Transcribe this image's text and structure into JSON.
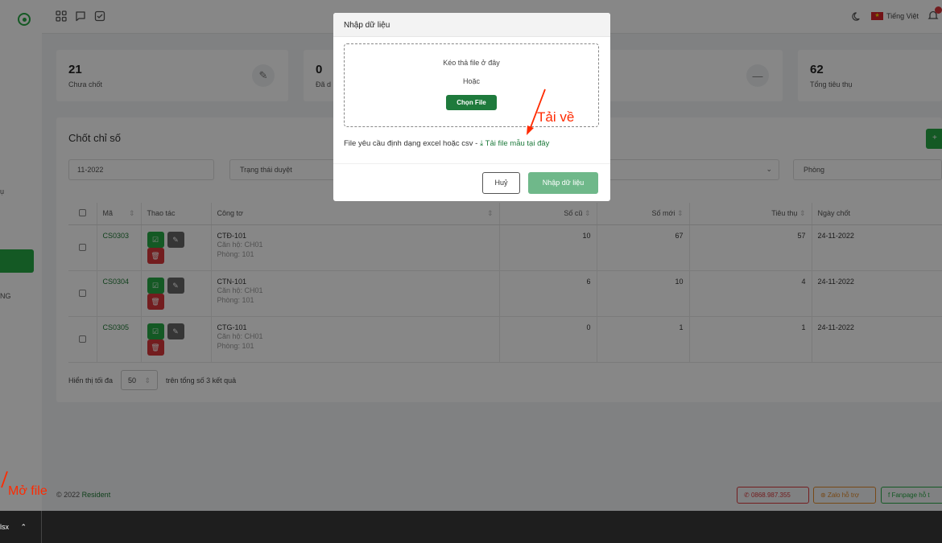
{
  "topbar": {
    "language": "Tiếng Việt"
  },
  "stats": [
    {
      "value": "21",
      "label": "Chưa chốt"
    },
    {
      "value": "0",
      "label": "Đã d"
    },
    {
      "value": "62",
      "label": "Tổng tiêu thụ"
    }
  ],
  "panel": {
    "title": "Chốt chỉ số",
    "filter_month": "11-2022",
    "filter_status": "Trạng thái duyệt",
    "filter_room": "Phòng",
    "add_label": "+"
  },
  "sidebar": {
    "fragment1": "ụ",
    "fragment2": "NG"
  },
  "table": {
    "headers": {
      "ma": "Mã",
      "thaotac": "Thao tác",
      "congto": "Công tơ",
      "socu": "Số cũ",
      "somoi": "Số mới",
      "tieuthu": "Tiêu thụ",
      "ngaychot": "Ngày chốt"
    },
    "rows": [
      {
        "code": "CS0303",
        "meter": "CTĐ-101",
        "apt": "Căn hộ: CH01",
        "room": "Phòng: 101",
        "old": "10",
        "new": "67",
        "usage": "57",
        "date": "24-11-2022"
      },
      {
        "code": "CS0304",
        "meter": "CTN-101",
        "apt": "Căn hộ: CH01",
        "room": "Phòng: 101",
        "old": "6",
        "new": "10",
        "usage": "4",
        "date": "24-11-2022"
      },
      {
        "code": "CS0305",
        "meter": "CTG-101",
        "apt": "Căn hộ: CH01",
        "room": "Phòng: 101",
        "old": "0",
        "new": "1",
        "usage": "1",
        "date": "24-11-2022"
      }
    ]
  },
  "pagination": {
    "prefix": "Hiển thị tối đa",
    "size": "50",
    "suffix": "trên tổng số 3 kết quả"
  },
  "footer": {
    "copyright": "© 2022",
    "brand": "Resident",
    "phone": "0868.987.355",
    "zalo": "Zalo hỗ trợ",
    "fanpage": "Fanpage hỗ t"
  },
  "taskbar": {
    "file": "lsx"
  },
  "modal": {
    "title": "Nhập dữ liệu",
    "drop_text": "Kéo thả file ở đây",
    "or_text": "Hoặc",
    "choose_label": "Chọn File",
    "note_text": "File yêu cầu định dạng excel hoặc csv -",
    "template_link": "Tải file mẫu tại đây",
    "cancel_label": "Huỷ",
    "submit_label": "Nhập dữ liệu"
  },
  "annotations": {
    "download": "Tải về",
    "open_file": "Mở file"
  },
  "colors": {
    "accent": "#1e7a3c",
    "danger": "#d9383b",
    "annotation": "#ff2a00"
  }
}
